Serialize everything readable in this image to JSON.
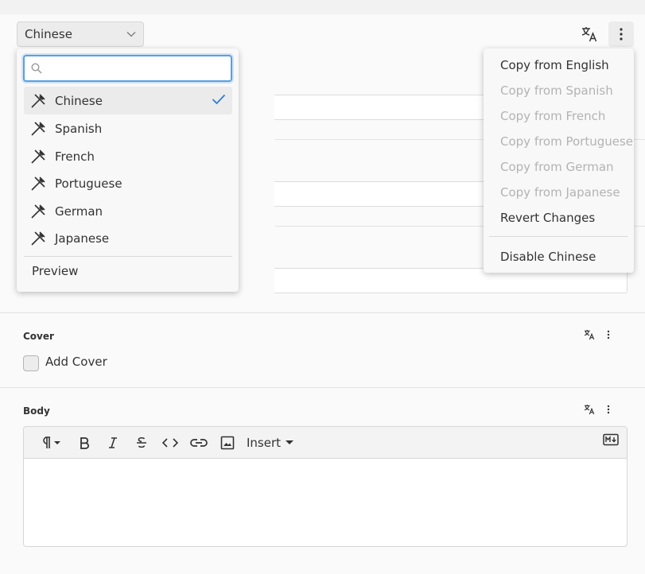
{
  "language_select": {
    "value": "Chinese"
  },
  "language_popup": {
    "search_placeholder": "",
    "items": [
      {
        "label": "Chinese",
        "selected": true
      },
      {
        "label": "Spanish",
        "selected": false
      },
      {
        "label": "French",
        "selected": false
      },
      {
        "label": "Portuguese",
        "selected": false
      },
      {
        "label": "German",
        "selected": false
      },
      {
        "label": "Japanese",
        "selected": false
      }
    ],
    "preview_label": "Preview"
  },
  "more_menu": {
    "items": [
      {
        "label": "Copy from English",
        "disabled": false
      },
      {
        "label": "Copy from Spanish",
        "disabled": true
      },
      {
        "label": "Copy from French",
        "disabled": true
      },
      {
        "label": "Copy from Portuguese",
        "disabled": true
      },
      {
        "label": "Copy from German",
        "disabled": true
      },
      {
        "label": "Copy from Japanese",
        "disabled": true
      },
      {
        "label": "Revert Changes",
        "disabled": false
      }
    ],
    "disable_label": "Disable Chinese"
  },
  "cover": {
    "label": "Cover",
    "checkbox_label": "Add Cover"
  },
  "body": {
    "label": "Body",
    "insert_label": "Insert"
  },
  "icons": {
    "translate": "translate-icon",
    "more": "more-vertical-icon",
    "language_flag": "translation-missing-icon",
    "check": "check-icon",
    "search": "search-icon"
  },
  "colors": {
    "accent": "#2f7dd3",
    "focus_border": "#5a9fe0",
    "disabled_text": "#b3b3b3"
  }
}
